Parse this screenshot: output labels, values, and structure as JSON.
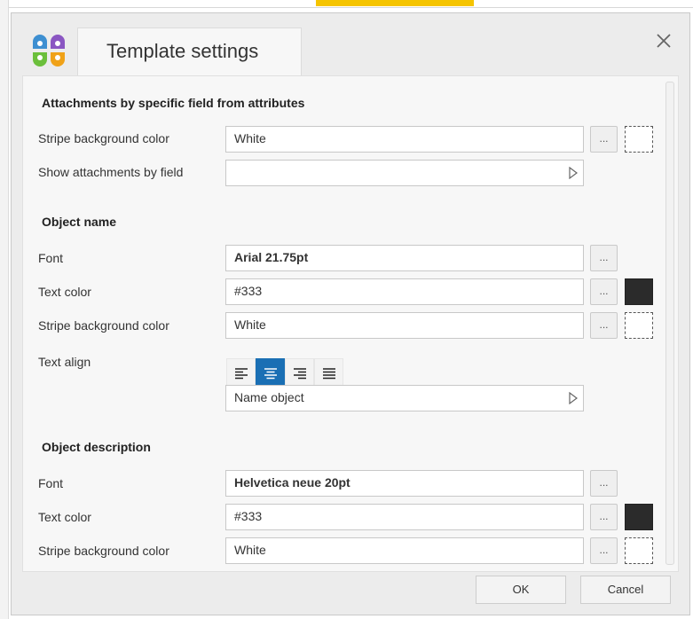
{
  "dialog": {
    "title": "Template settings",
    "close_icon": "close-icon",
    "logo_icon": "app-logo-icon"
  },
  "sections": {
    "attachments": {
      "title": "Attachments by specific field from attributes",
      "stripe_bg": {
        "label": "Stripe background color",
        "value": "White"
      },
      "show_by_field": {
        "label": "Show attachments by field",
        "value": ""
      }
    },
    "object_name": {
      "title": "Object name",
      "font": {
        "label": "Font",
        "value": "Arial 21.75pt"
      },
      "text_color": {
        "label": "Text color",
        "value": "#333"
      },
      "stripe_bg": {
        "label": "Stripe background color",
        "value": "White"
      },
      "text_align": {
        "label": "Text align",
        "selected": "center"
      },
      "name_field": {
        "value": "Name object"
      }
    },
    "object_description": {
      "title": "Object description",
      "font": {
        "label": "Font",
        "value": "Helvetica neue 20pt"
      },
      "text_color": {
        "label": "Text color",
        "value": "#333"
      },
      "stripe_bg": {
        "label": "Stripe background color",
        "value": "White"
      }
    }
  },
  "buttons": {
    "dots": "...",
    "ok": "OK",
    "cancel": "Cancel"
  },
  "colors": {
    "accent": "#1a6fb4",
    "swatch_dark": "#2b2b2b",
    "dialog_bg": "#ececec"
  }
}
